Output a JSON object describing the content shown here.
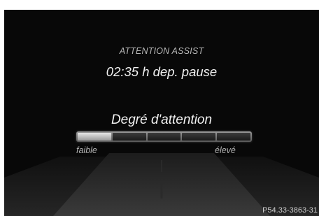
{
  "display": {
    "title": "ATTENTION ASSIST",
    "pause_text": "02:35 h dep. pause",
    "degree_label": "Degré d'attention",
    "scale_low_label": "faible",
    "scale_high_label": "élevé",
    "attention_level": {
      "filled_segments": 1,
      "total_segments": 5
    },
    "image_code": "P54.33-3863-31"
  },
  "colors": {
    "background": "#080808",
    "primary_text": "#f2f2f2",
    "secondary_text": "#b8b8b8"
  }
}
